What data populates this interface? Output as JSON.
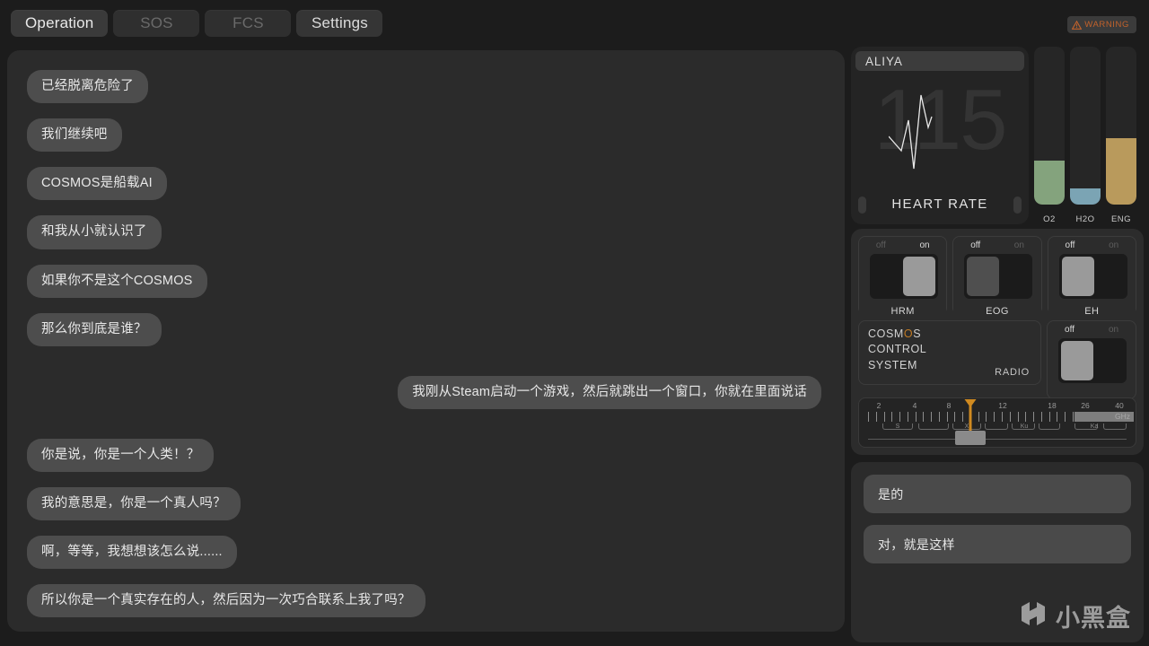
{
  "tabs": [
    {
      "label": "Operation",
      "state": "active"
    },
    {
      "label": "SOS",
      "state": "dim"
    },
    {
      "label": "FCS",
      "state": "dim"
    },
    {
      "label": "Settings",
      "state": "semi"
    }
  ],
  "warning": {
    "label": "WARNING",
    "icon": "warning-triangle-icon",
    "color": "#c2622b"
  },
  "chat": {
    "messages": [
      {
        "side": "left",
        "text": "已经脱离危险了"
      },
      {
        "side": "left",
        "text": "我们继续吧"
      },
      {
        "side": "left",
        "text": "COSMOS是船载AI"
      },
      {
        "side": "left",
        "text": "和我从小就认识了"
      },
      {
        "side": "left",
        "text": "如果你不是这个COSMOS"
      },
      {
        "side": "left",
        "text": "那么你到底是谁？"
      },
      {
        "side": "right",
        "text": "我刚从Steam启动一个游戏，然后就跳出一个窗口，你就在里面说话"
      },
      {
        "side": "left",
        "text": "你是说，你是一个人类！？"
      },
      {
        "side": "left",
        "text": "我的意思是，你是一个真人吗？"
      },
      {
        "side": "left",
        "text": "啊，等等，我想想该怎么说......"
      },
      {
        "side": "left",
        "text": "所以你是一个真实存在的人，然后因为一次巧合联系上我了吗？"
      }
    ]
  },
  "vitals": {
    "name": "ALIYA",
    "heart_rate": "115",
    "heart_rate_label": "HEART RATE"
  },
  "gauges": [
    {
      "label": "O2",
      "percent": 28,
      "color": "#84a37d"
    },
    {
      "label": "H2O",
      "percent": 10,
      "color": "#7ba4b4"
    },
    {
      "label": "ENG",
      "percent": 42,
      "color": "#b99a5c"
    }
  ],
  "switches": [
    {
      "name": "HRM",
      "off_label": "off",
      "on_label": "on",
      "state": "on"
    },
    {
      "name": "EOG",
      "off_label": "off",
      "on_label": "on",
      "state": "off"
    },
    {
      "name": "EH",
      "off_label": "off",
      "on_label": "on",
      "state": "off"
    }
  ],
  "cosmos": {
    "line1": "COSMOS",
    "line2": "CONTROL",
    "line3": "SYSTEM",
    "radio_label": "RADIO",
    "radio": {
      "off_label": "off",
      "on_label": "on",
      "state": "off"
    }
  },
  "frequency": {
    "unit": "GHz",
    "numbers": [
      "2",
      "4",
      "8",
      "12",
      "18",
      "26",
      "40"
    ],
    "bands": [
      "S",
      "X",
      "Ku",
      "Ka"
    ],
    "selected_band": "X"
  },
  "replies": [
    {
      "text": "是的"
    },
    {
      "text": "对，就是这样"
    }
  ],
  "watermark": {
    "text": "小黑盒",
    "logo": "xiaoheihe-logo-icon"
  }
}
